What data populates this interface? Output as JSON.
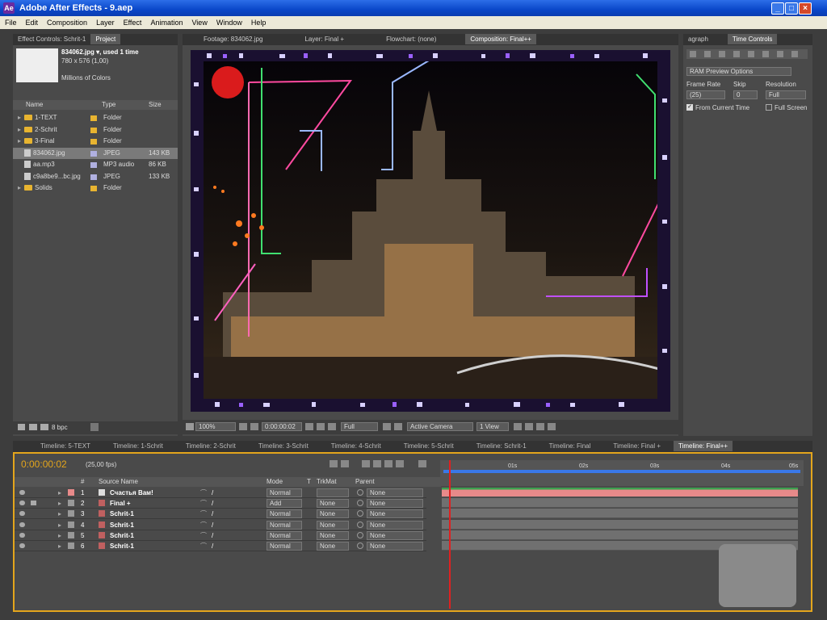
{
  "window": {
    "title": "Adobe After Effects - 9.aep",
    "minimize": "_",
    "maximize": "□",
    "close": "×"
  },
  "menu": [
    "File",
    "Edit",
    "Composition",
    "Layer",
    "Effect",
    "Animation",
    "View",
    "Window",
    "Help"
  ],
  "project_panel": {
    "tabs": [
      "Effect Controls: Schrit-1",
      "Project"
    ],
    "info": {
      "name": "834062.jpg ▾, used 1 time",
      "size": "780 x 576 (1,00)",
      "colors": "Millions of Colors"
    },
    "columns": [
      "Name",
      "Type",
      "Size"
    ],
    "items": [
      {
        "name": "1-TEXT",
        "type": "Folder",
        "size": "",
        "kind": "folder"
      },
      {
        "name": "2-Schrit",
        "type": "Folder",
        "size": "",
        "kind": "folder"
      },
      {
        "name": "3-Final",
        "type": "Folder",
        "size": "",
        "kind": "folder"
      },
      {
        "name": "834062.jpg",
        "type": "JPEG",
        "size": "143 KB",
        "kind": "file"
      },
      {
        "name": "aa.mp3",
        "type": "MP3 audio",
        "size": "86 KB",
        "kind": "file"
      },
      {
        "name": "c9a8be9...bc.jpg",
        "type": "JPEG",
        "size": "133 KB",
        "kind": "file"
      },
      {
        "name": "Solids",
        "type": "Folder",
        "size": "",
        "kind": "folder"
      }
    ],
    "bpc": "8 bpc"
  },
  "comp_panel": {
    "tabs": [
      "Footage: 834062.jpg",
      "Layer: Final +",
      "Flowchart: (none)",
      "Composition: Final++"
    ],
    "zoom": "100%",
    "timecode": "0:00:00:02",
    "resolution": "Full",
    "camera": "Active Camera",
    "views": "1 View"
  },
  "time_controls": {
    "tabs": [
      "agraph",
      "Time Controls"
    ],
    "ram_preview": "RAM Preview Options",
    "frame_rate_label": "Frame Rate",
    "frame_rate": "(25)",
    "skip_label": "Skip",
    "skip": "0",
    "resolution_label": "Resolution",
    "resolution": "Full",
    "from_current": "From Current Time",
    "full_screen": "Full Screen"
  },
  "timeline": {
    "tabs": [
      "Timeline: 5-TEXT",
      "Timeline: 1-Schrit",
      "Timeline: 2-Schrit",
      "Timeline: 3-Schrit",
      "Timeline: 4-Schrit",
      "Timeline: 5-Schrit",
      "Timeline: Schrit-1",
      "Timeline: Final",
      "Timeline: Final +",
      "Timeline: Final++"
    ],
    "timecode": "0:00:00:02",
    "fps": "(25,00 fps)",
    "columns": {
      "num": "#",
      "source": "Source Name",
      "mode": "Mode",
      "t": "T",
      "trkmat": "TrkMat",
      "parent": "Parent"
    },
    "ruler": [
      "01s",
      "02s",
      "03s",
      "04s",
      "05s"
    ],
    "playhead_seconds": 0.08,
    "duration_seconds": 5,
    "layers": [
      {
        "num": "1",
        "name": "Счастья Вам!",
        "mode": "Normal",
        "trkmat": "",
        "parent": "None",
        "color": "#e88a8a"
      },
      {
        "num": "2",
        "name": "Final +",
        "mode": "Add",
        "trkmat": "None",
        "parent": "None",
        "color": "#999"
      },
      {
        "num": "3",
        "name": "Schrit-1",
        "mode": "Normal",
        "trkmat": "None",
        "parent": "None",
        "color": "#999"
      },
      {
        "num": "4",
        "name": "Schrit-1",
        "mode": "Normal",
        "trkmat": "None",
        "parent": "None",
        "color": "#999"
      },
      {
        "num": "5",
        "name": "Schrit-1",
        "mode": "Normal",
        "trkmat": "None",
        "parent": "None",
        "color": "#999"
      },
      {
        "num": "6",
        "name": "Schrit-1",
        "mode": "Normal",
        "trkmat": "None",
        "parent": "None",
        "color": "#999"
      }
    ]
  }
}
